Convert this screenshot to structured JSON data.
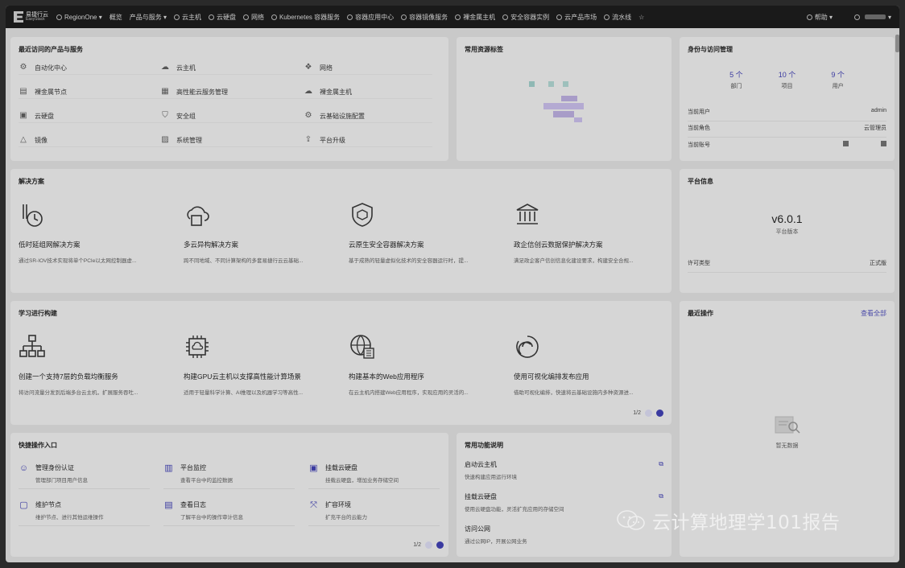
{
  "topbar": {
    "logo_cn": "易捷行云",
    "logo_en": "EasyStack",
    "region": "RegionOne ▾",
    "nav": [
      "概览",
      "产品与服务 ▾",
      "云主机",
      "云硬盘",
      "网络",
      "Kubernetes 容器服务",
      "容器应用中心",
      "容器镜像服务",
      "裸金属主机",
      "安全容器实例",
      "云产品市场",
      "流水线"
    ],
    "help": "帮助 ▾"
  },
  "recent": {
    "title": "最近访问的产品与服务",
    "items": [
      {
        "label": "自动化中心",
        "icon": "automation-icon"
      },
      {
        "label": "云主机",
        "icon": "cloud-host-icon"
      },
      {
        "label": "网络",
        "icon": "network-icon"
      },
      {
        "label": "裸金属节点",
        "icon": "bare-metal-node-icon"
      },
      {
        "label": "高性能云服务管理",
        "icon": "hpc-icon"
      },
      {
        "label": "裸金属主机",
        "icon": "bare-metal-host-icon"
      },
      {
        "label": "云硬盘",
        "icon": "disk-icon"
      },
      {
        "label": "安全组",
        "icon": "security-group-icon"
      },
      {
        "label": "云基础设施配置",
        "icon": "gear-icon"
      },
      {
        "label": "镜像",
        "icon": "image-icon"
      },
      {
        "label": "系统管理",
        "icon": "system-icon"
      },
      {
        "label": "平台升级",
        "icon": "upgrade-icon"
      }
    ]
  },
  "tags": {
    "title": "常用资源标签"
  },
  "identity": {
    "title": "身份与访问管理",
    "stats": [
      {
        "num": "5 个",
        "label": "部门"
      },
      {
        "num": "10 个",
        "label": "项目"
      },
      {
        "num": "9 个",
        "label": "用户"
      }
    ],
    "current_user_label": "当前用户",
    "current_user": "admin",
    "current_role_label": "当前角色",
    "current_role": "云管理员",
    "current_account_label": "当前账号"
  },
  "solutions": {
    "title": "解决方案",
    "items": [
      {
        "title": "低时延组网解决方案",
        "desc": "通过SR-IOV技术实现将单个PCIe以太网控制器虚...",
        "icon": "latency-icon"
      },
      {
        "title": "多云异构解决方案",
        "desc": "跨不同地域、不同计算架构的多套易捷行云云基础...",
        "icon": "multicloud-icon"
      },
      {
        "title": "云原生安全容器解决方案",
        "desc": "基于成熟的轻量虚拟化技术的安全容器运行时，提...",
        "icon": "shield-icon"
      },
      {
        "title": "政企信创云数据保护解决方案",
        "desc": "满足政企客户信创信息化建设要求，构建安全合规...",
        "icon": "government-icon"
      }
    ]
  },
  "platform": {
    "title": "平台信息",
    "version": "v6.0.1",
    "version_label": "平台版本",
    "license_label": "许可类型",
    "license": "正式版"
  },
  "learning": {
    "title": "学习进行构建",
    "items": [
      {
        "title": "创建一个支持7层的负载均衡服务",
        "desc": "将访问流量分发到后端多台云主机，扩展服务吞吐...",
        "icon": "load-balancer-icon"
      },
      {
        "title": "构建GPU云主机以支撑高性能计算场景",
        "desc": "适用于轻量科学计算、AI推理以及机器学习等高性...",
        "icon": "gpu-chip-icon"
      },
      {
        "title": "构建基本的Web应用程序",
        "desc": "在云主机内搭建Web应用程序，实现应用的灵活的...",
        "icon": "web-app-icon"
      },
      {
        "title": "使用可视化编排发布应用",
        "desc": "借助可视化编排，快速将云基础设施内多种资源进...",
        "icon": "orchestration-icon"
      }
    ],
    "page": "1/2"
  },
  "recent_ops": {
    "title": "最近操作",
    "view_all": "查看全部",
    "empty": "暂无数据"
  },
  "quick": {
    "title": "快捷操作入口",
    "items": [
      {
        "title": "管理身份认证",
        "desc": "管理部门项目用户信息",
        "icon": "user-icon"
      },
      {
        "title": "平台监控",
        "desc": "查看平台中的监控数据",
        "icon": "monitor-icon"
      },
      {
        "title": "挂载云硬盘",
        "desc": "挂载云硬盘，增加业务存储空间",
        "icon": "attach-disk-icon"
      },
      {
        "title": "维护节点",
        "desc": "维护节点、进行其他运维操作",
        "icon": "node-icon"
      },
      {
        "title": "查看日志",
        "desc": "了解平台中的操作审计信息",
        "icon": "log-icon"
      },
      {
        "title": "扩容环境",
        "desc": "扩充平台的云能力",
        "icon": "expand-icon"
      }
    ],
    "page": "1/2"
  },
  "functions": {
    "title": "常用功能说明",
    "items": [
      {
        "title": "启动云主机",
        "desc": "快速构建应用运行环境"
      },
      {
        "title": "挂载云硬盘",
        "desc": "使用云硬盘功能，灵活扩充应用的存储空间"
      },
      {
        "title": "访问公网",
        "desc": "通过公网IP，开展公网业务"
      }
    ]
  },
  "watermark": {
    "text": "云计算地理学101报告"
  }
}
